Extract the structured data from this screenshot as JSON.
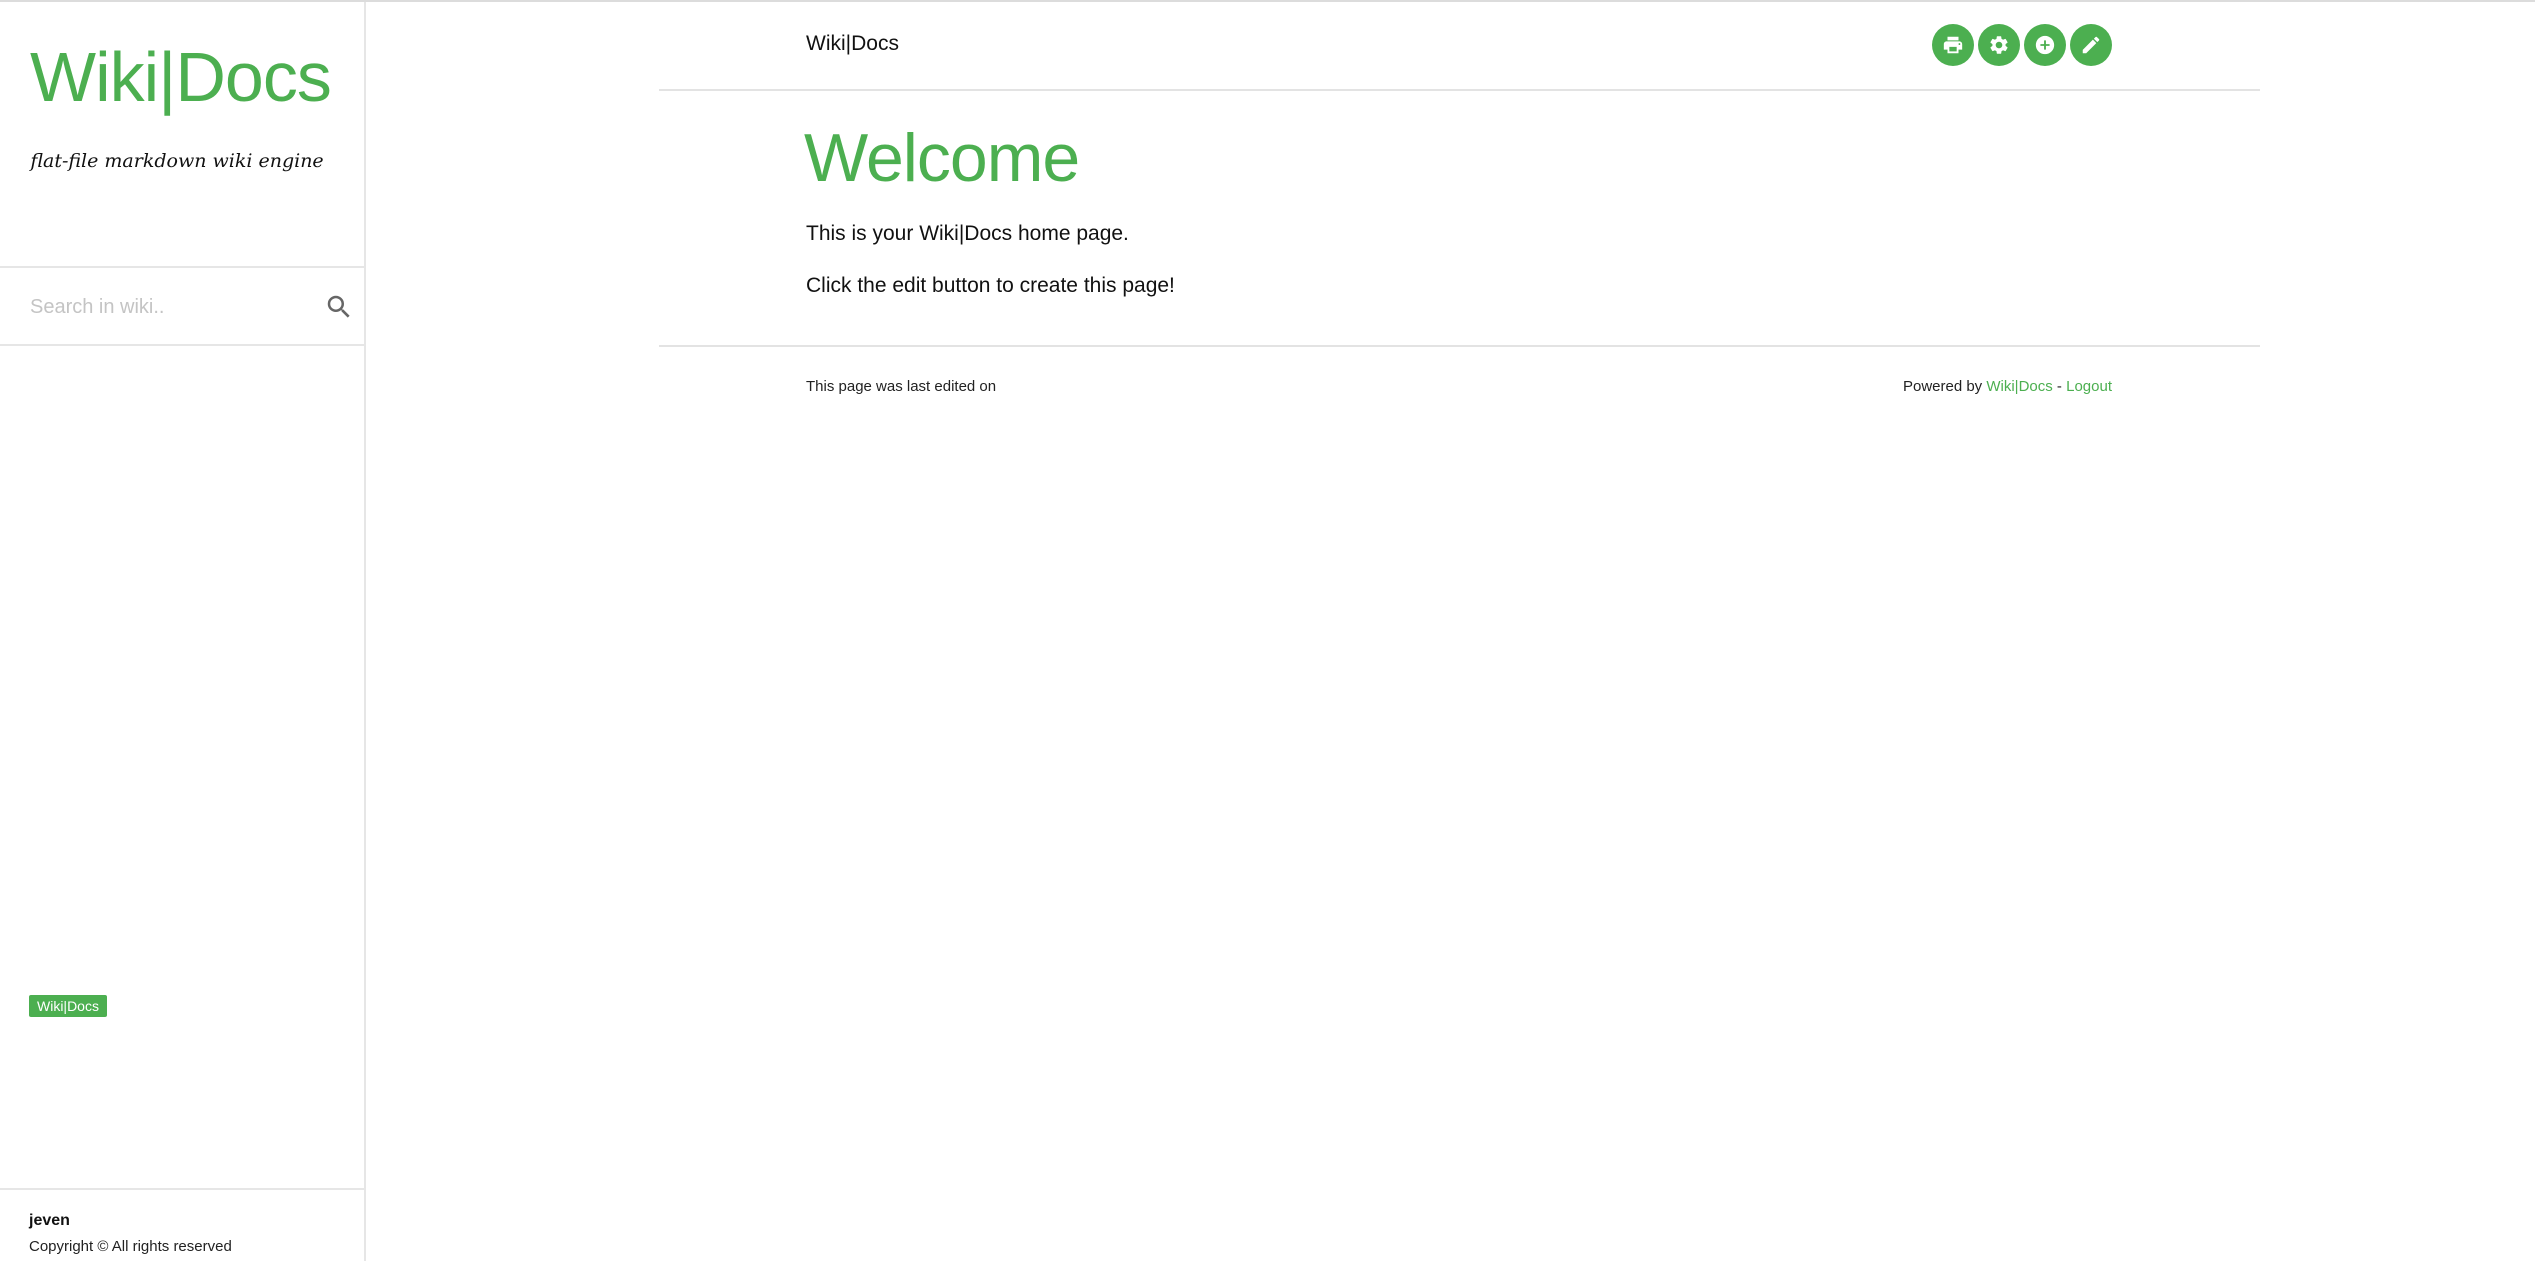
{
  "sidebar": {
    "brand": "Wiki|Docs",
    "tagline": "flat-file markdown wiki engine",
    "search": {
      "placeholder": "Search in wiki..",
      "value": ""
    },
    "badge": "Wiki|Docs",
    "username": "jeven",
    "copyright": "Copyright © All rights reserved"
  },
  "header": {
    "title": "Wiki|Docs",
    "actions": [
      {
        "name": "print",
        "icon": "print-icon"
      },
      {
        "name": "settings",
        "icon": "gear-icon"
      },
      {
        "name": "add",
        "icon": "plus-circle-icon"
      },
      {
        "name": "edit",
        "icon": "pencil-icon"
      }
    ]
  },
  "content": {
    "title": "Welcome",
    "paragraphs": [
      "This is your Wiki|Docs home page.",
      "Click the edit button to create this page!"
    ]
  },
  "footer": {
    "last_edited": "This page was last edited on",
    "powered_prefix": "Powered by ",
    "powered_link": "Wiki|Docs",
    "separator": " - ",
    "logout": "Logout"
  },
  "colors": {
    "accent": "#4caf50",
    "divider": "#e3e3e3"
  }
}
